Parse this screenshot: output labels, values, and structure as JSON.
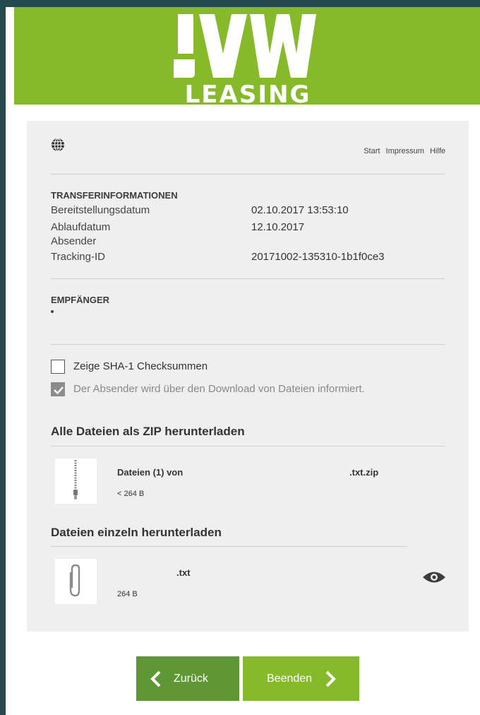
{
  "header": {
    "logo_text": "LEASING"
  },
  "nav": {
    "start": "Start",
    "impressum": "Impressum",
    "hilfe": "Hilfe"
  },
  "transfer": {
    "title": "TRANSFERINFORMATIONEN",
    "rows": [
      {
        "label": "Bereitstellungsdatum",
        "value": "02.10.2017 13:53:10"
      },
      {
        "label": "Ablaufdatum",
        "value": "12.10.2017"
      },
      {
        "label": "Absender",
        "value": ""
      },
      {
        "label": "Tracking-ID",
        "value": "20171002-135310-1b1f0ce3"
      }
    ]
  },
  "recipients": {
    "title": "EMPFÄNGER"
  },
  "options": {
    "sha1_label": "Zeige SHA-1 Checksummen",
    "sha1_checked": false,
    "notify_label": "Der Absender wird über den Download von Dateien informiert.",
    "notify_checked": true
  },
  "zip_section": {
    "title": "Alle Dateien als ZIP herunterladen",
    "file_name": "Dateien (1) von",
    "file_ext": ".txt.zip",
    "file_size": "< 264 B"
  },
  "single_section": {
    "title": "Dateien einzeln herunterladen",
    "file_ext": ".txt",
    "file_size": "264 B"
  },
  "buttons": {
    "back": "Zurück",
    "finish": "Beenden"
  },
  "colors": {
    "brand_green": "#86ba2a",
    "dark_green": "#5f9734",
    "frame": "#254a4e"
  },
  "icons": {
    "globe": "globe-icon",
    "zip": "zip-icon",
    "paperclip": "paperclip-icon",
    "eye": "eye-icon"
  }
}
